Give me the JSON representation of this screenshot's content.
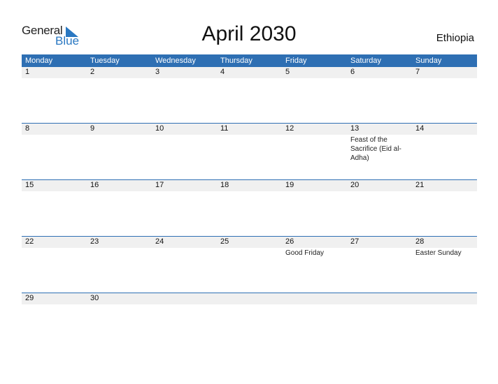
{
  "logo": {
    "general": "General",
    "blue": "Blue"
  },
  "title": "April 2030",
  "country": "Ethiopia",
  "weekdays": [
    "Monday",
    "Tuesday",
    "Wednesday",
    "Thursday",
    "Friday",
    "Saturday",
    "Sunday"
  ],
  "weeks": [
    [
      {
        "d": "1"
      },
      {
        "d": "2"
      },
      {
        "d": "3"
      },
      {
        "d": "4"
      },
      {
        "d": "5"
      },
      {
        "d": "6"
      },
      {
        "d": "7"
      }
    ],
    [
      {
        "d": "8"
      },
      {
        "d": "9"
      },
      {
        "d": "10"
      },
      {
        "d": "11"
      },
      {
        "d": "12"
      },
      {
        "d": "13",
        "event": "Feast of the Sacrifice (Eid al-Adha)"
      },
      {
        "d": "14"
      }
    ],
    [
      {
        "d": "15"
      },
      {
        "d": "16"
      },
      {
        "d": "17"
      },
      {
        "d": "18"
      },
      {
        "d": "19"
      },
      {
        "d": "20"
      },
      {
        "d": "21"
      }
    ],
    [
      {
        "d": "22"
      },
      {
        "d": "23"
      },
      {
        "d": "24"
      },
      {
        "d": "25"
      },
      {
        "d": "26",
        "event": "Good Friday"
      },
      {
        "d": "27"
      },
      {
        "d": "28",
        "event": "Easter Sunday"
      }
    ],
    [
      {
        "d": "29"
      },
      {
        "d": "30"
      }
    ]
  ],
  "colors": {
    "header": "#2e6fb3",
    "brand_blue": "#2a78c2",
    "strip": "#f0f0f0"
  }
}
